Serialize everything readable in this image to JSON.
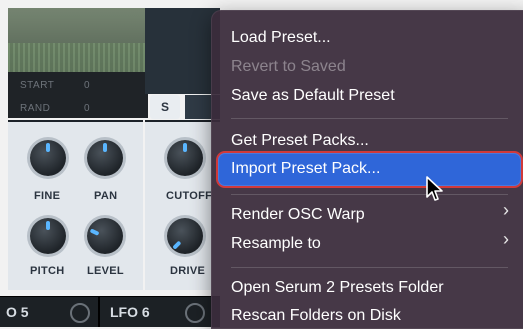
{
  "app": {
    "osc": {
      "start_label": "START",
      "start_value": "0",
      "rand_label": "RAND",
      "rand_value": "0"
    },
    "tabs": {
      "s_label": "S"
    },
    "knobs": {
      "fine_label": "FINE",
      "pan_label": "PAN",
      "pitch_label": "PITCH",
      "level_label": "LEVEL",
      "cutoff_label": "CUTOFF",
      "drive_label": "DRIVE"
    },
    "bottom": {
      "lfo5_label": "O 5",
      "lfo6_label": "LFO 6"
    }
  },
  "context_menu": {
    "items": [
      {
        "label": "Load Preset...",
        "enabled": true
      },
      {
        "label": "Revert to Saved",
        "enabled": false
      },
      {
        "label": "Save as Default Preset",
        "enabled": true
      },
      {
        "label": "Get Preset Packs...",
        "enabled": true
      },
      {
        "label": "Import Preset Pack...",
        "enabled": true,
        "highlighted": true
      },
      {
        "label": "Render OSC Warp",
        "enabled": true,
        "submenu": true
      },
      {
        "label": "Resample to",
        "enabled": true,
        "submenu": true
      },
      {
        "label": "Open Serum 2 Presets Folder",
        "enabled": true
      },
      {
        "label": "Rescan Folders on Disk",
        "enabled": true
      }
    ],
    "submenu_glyph": "›"
  },
  "colors": {
    "menu_bg": "#3a2c3c",
    "highlight": "#2f66d9",
    "highlight_outline": "#d13a3a",
    "knob_accent": "#5ab6ff"
  }
}
